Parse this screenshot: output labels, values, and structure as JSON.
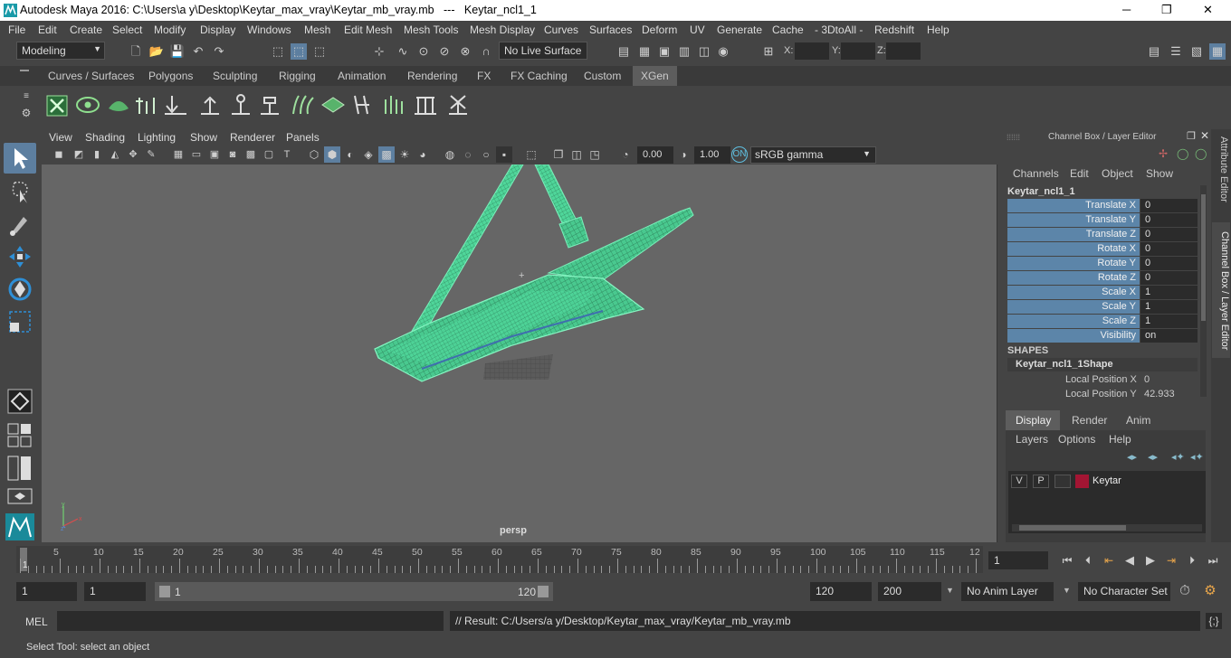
{
  "window": {
    "title": "Autodesk Maya 2016: C:\\Users\\a y\\Desktop\\Keytar_max_vray\\Keytar_mb_vray.mb   ---   Keytar_ncl1_1",
    "minimize": "─",
    "maximize": "❐",
    "close": "✕"
  },
  "menu": [
    "File",
    "Edit",
    "Create",
    "Select",
    "Modify",
    "Display",
    "Windows",
    "Mesh",
    "Edit Mesh",
    "Mesh Tools",
    "Mesh Display",
    "Curves",
    "Surfaces",
    "Deform",
    "UV",
    "Generate",
    "Cache",
    "- 3DtoAll -",
    "Redshift",
    "Help"
  ],
  "status": {
    "mode": "Modeling",
    "live_surface": "No Live Surface",
    "x_label": "X:",
    "y_label": "Y:",
    "z_label": "Z:"
  },
  "shelf_tabs": [
    "Curves / Surfaces",
    "Polygons",
    "Sculpting",
    "Rigging",
    "Animation",
    "Rendering",
    "FX",
    "FX Caching",
    "Custom",
    "XGen"
  ],
  "panel_menu": [
    "View",
    "Shading",
    "Lighting",
    "Show",
    "Renderer",
    "Panels"
  ],
  "panel_tools": {
    "exposure": "0.00",
    "gamma": "1.00",
    "color_space": "sRGB gamma"
  },
  "viewport": {
    "camera": "persp"
  },
  "channel_box": {
    "header": "Channel Box / Layer Editor",
    "menus": [
      "Channels",
      "Edit",
      "Object",
      "Show"
    ],
    "object_name": "Keytar_ncl1_1",
    "attributes": [
      {
        "label": "Translate X",
        "value": "0"
      },
      {
        "label": "Translate Y",
        "value": "0"
      },
      {
        "label": "Translate Z",
        "value": "0"
      },
      {
        "label": "Rotate X",
        "value": "0"
      },
      {
        "label": "Rotate Y",
        "value": "0"
      },
      {
        "label": "Rotate Z",
        "value": "0"
      },
      {
        "label": "Scale X",
        "value": "1"
      },
      {
        "label": "Scale Y",
        "value": "1"
      },
      {
        "label": "Scale Z",
        "value": "1"
      },
      {
        "label": "Visibility",
        "value": "on"
      }
    ],
    "shapes_header": "SHAPES",
    "shape_name": "Keytar_ncl1_1Shape",
    "shape_attrs": [
      {
        "label": "Local Position X",
        "value": "0"
      },
      {
        "label": "Local Position Y",
        "value": "42.933"
      }
    ]
  },
  "layer_editor": {
    "tabs": [
      "Display",
      "Render",
      "Anim"
    ],
    "menus": [
      "Layers",
      "Options",
      "Help"
    ],
    "layer": {
      "v": "V",
      "p": "P",
      "name": "Keytar",
      "color": "#a31533"
    }
  },
  "side_tabs": [
    "Attribute Editor",
    "Channel Box / Layer Editor"
  ],
  "timeline": {
    "ticks": [
      "5",
      "10",
      "15",
      "20",
      "25",
      "30",
      "35",
      "40",
      "45",
      "50",
      "55",
      "60",
      "65",
      "70",
      "75",
      "80",
      "85",
      "90",
      "95",
      "100",
      "105",
      "110",
      "115",
      "12"
    ],
    "start_marker": "1",
    "current_frame": "1"
  },
  "range": {
    "start": "1",
    "playback_start": "1",
    "slider_start": "1",
    "slider_end": "120",
    "playback_end": "120",
    "end": "200",
    "anim_layer": "No Anim Layer",
    "character_set": "No Character Set"
  },
  "command": {
    "lang": "MEL",
    "result": "// Result: C:/Users/a y/Desktop/Keytar_max_vray/Keytar_mb_vray.mb"
  },
  "help_line": "Select Tool: select an object",
  "colors": {
    "wire": "#5de6a4",
    "channel_label": "#5c85a9",
    "active_tab": "#5d5d5d"
  }
}
